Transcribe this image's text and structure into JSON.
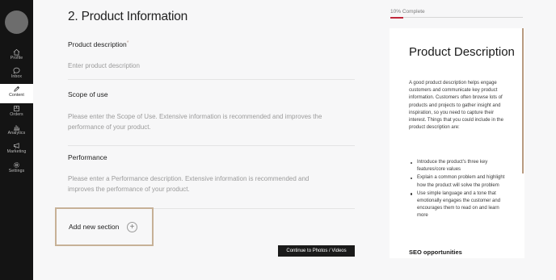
{
  "sidebar": {
    "items": [
      {
        "label": "Profile",
        "icon": "home-icon"
      },
      {
        "label": "Inbox",
        "icon": "chat-icon"
      },
      {
        "label": "Content",
        "icon": "pencil-icon"
      },
      {
        "label": "Orders",
        "icon": "box-icon"
      },
      {
        "label": "Analytics",
        "icon": "bar-chart-icon"
      },
      {
        "label": "Marketing",
        "icon": "megaphone-icon"
      },
      {
        "label": "Settings",
        "icon": "gear-icon"
      }
    ],
    "active": "Content"
  },
  "form": {
    "title": "2. Product Information",
    "product_description": {
      "label": "Product description",
      "required_mark": "*",
      "placeholder": "Enter product description"
    },
    "scope_of_use": {
      "label": "Scope of use",
      "placeholder": "Please enter the Scope of Use. Extensive information is recommended and improves the performance of your product."
    },
    "performance": {
      "label": "Performance",
      "placeholder": "Please enter a Performance description. Extensive information is recommended and improves the performance of your product."
    },
    "add_section_label": "Add new section",
    "add_section_icon": "plus-icon",
    "continue_label": "Continue to Photos / Videos"
  },
  "progress": {
    "text": "10% Complete",
    "percent": 10,
    "color": "#c0273b"
  },
  "help": {
    "title": "Product Description",
    "body": "A good product description helps engage customers and communicate key product information. Customers often browse lots of products and projects to gather insight and inspiration, so you need to capture their interest. Things that you could include in the product description are:",
    "bullets": [
      "Introduce the product's three key features/core values",
      "Explain a common problem and highlight how the product will solve the problem",
      "Use simple language and a tone that emotionally engages the customer and encourages them to read on and learn more"
    ],
    "subtitle": "SEO opportunities"
  },
  "colors": {
    "sidebar_bg": "#141414",
    "accent_border": "#c7b197",
    "progress": "#c0273b"
  }
}
